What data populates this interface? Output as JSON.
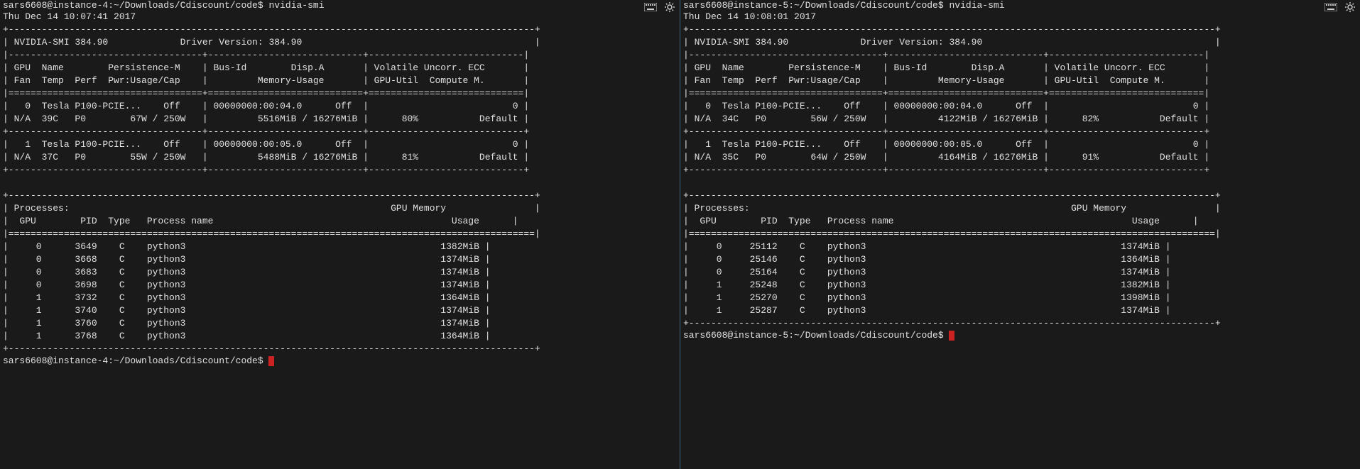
{
  "left": {
    "prompt": "sars6608@instance-4:~/Downloads/Cdiscount/code$",
    "command": "nvidia-smi",
    "timestamp": "Thu Dec 14 10:07:41 2017",
    "smi_version": "NVIDIA-SMI 384.90",
    "driver_version": "Driver Version: 384.90",
    "gpus": [
      {
        "idx": "0",
        "name": "Tesla P100-PCIE...",
        "pers": "Off",
        "bus": "00000000:00:04.0",
        "disp": "Off",
        "ecc": "0",
        "fan": "N/A",
        "temp": "39C",
        "perf": "P0",
        "pwr": "67W / 250W",
        "mem": "5516MiB / 16276MiB",
        "util": "80%",
        "comp": "Default"
      },
      {
        "idx": "1",
        "name": "Tesla P100-PCIE...",
        "pers": "Off",
        "bus": "00000000:00:05.0",
        "disp": "Off",
        "ecc": "0",
        "fan": "N/A",
        "temp": "37C",
        "perf": "P0",
        "pwr": "55W / 250W",
        "mem": "5488MiB / 16276MiB",
        "util": "81%",
        "comp": "Default"
      }
    ],
    "procs": [
      {
        "gpu": "0",
        "pid": "3649",
        "type": "C",
        "name": "python3",
        "mem": "1382MiB"
      },
      {
        "gpu": "0",
        "pid": "3668",
        "type": "C",
        "name": "python3",
        "mem": "1374MiB"
      },
      {
        "gpu": "0",
        "pid": "3683",
        "type": "C",
        "name": "python3",
        "mem": "1374MiB"
      },
      {
        "gpu": "0",
        "pid": "3698",
        "type": "C",
        "name": "python3",
        "mem": "1374MiB"
      },
      {
        "gpu": "1",
        "pid": "3732",
        "type": "C",
        "name": "python3",
        "mem": "1364MiB"
      },
      {
        "gpu": "1",
        "pid": "3740",
        "type": "C",
        "name": "python3",
        "mem": "1374MiB"
      },
      {
        "gpu": "1",
        "pid": "3760",
        "type": "C",
        "name": "python3",
        "mem": "1374MiB"
      },
      {
        "gpu": "1",
        "pid": "3768",
        "type": "C",
        "name": "python3",
        "mem": "1364MiB"
      }
    ],
    "prompt2": "sars6608@instance-4:~/Downloads/Cdiscount/code$"
  },
  "right": {
    "prompt": "sars6608@instance-5:~/Downloads/Cdiscount/code$",
    "command": "nvidia-smi",
    "timestamp": "Thu Dec 14 10:08:01 2017",
    "smi_version": "NVIDIA-SMI 384.90",
    "driver_version": "Driver Version: 384.90",
    "gpus": [
      {
        "idx": "0",
        "name": "Tesla P100-PCIE...",
        "pers": "Off",
        "bus": "00000000:00:04.0",
        "disp": "Off",
        "ecc": "0",
        "fan": "N/A",
        "temp": "34C",
        "perf": "P0",
        "pwr": "56W / 250W",
        "mem": "4122MiB / 16276MiB",
        "util": "82%",
        "comp": "Default"
      },
      {
        "idx": "1",
        "name": "Tesla P100-PCIE...",
        "pers": "Off",
        "bus": "00000000:00:05.0",
        "disp": "Off",
        "ecc": "0",
        "fan": "N/A",
        "temp": "35C",
        "perf": "P0",
        "pwr": "64W / 250W",
        "mem": "4164MiB / 16276MiB",
        "util": "91%",
        "comp": "Default"
      }
    ],
    "procs": [
      {
        "gpu": "0",
        "pid": "25112",
        "type": "C",
        "name": "python3",
        "mem": "1374MiB"
      },
      {
        "gpu": "0",
        "pid": "25146",
        "type": "C",
        "name": "python3",
        "mem": "1364MiB"
      },
      {
        "gpu": "0",
        "pid": "25164",
        "type": "C",
        "name": "python3",
        "mem": "1374MiB"
      },
      {
        "gpu": "1",
        "pid": "25248",
        "type": "C",
        "name": "python3",
        "mem": "1382MiB"
      },
      {
        "gpu": "1",
        "pid": "25270",
        "type": "C",
        "name": "python3",
        "mem": "1398MiB"
      },
      {
        "gpu": "1",
        "pid": "25287",
        "type": "C",
        "name": "python3",
        "mem": "1374MiB"
      }
    ],
    "prompt2": "sars6608@instance-5:~/Downloads/Cdiscount/code$"
  },
  "labels": {
    "processes": "Processes:",
    "proc_hdr_gpu": "GPU",
    "proc_hdr_pid": "PID",
    "proc_hdr_type": "Type",
    "proc_hdr_name": "Process name",
    "proc_hdr_mem1": "GPU Memory",
    "proc_hdr_mem2": "Usage"
  }
}
